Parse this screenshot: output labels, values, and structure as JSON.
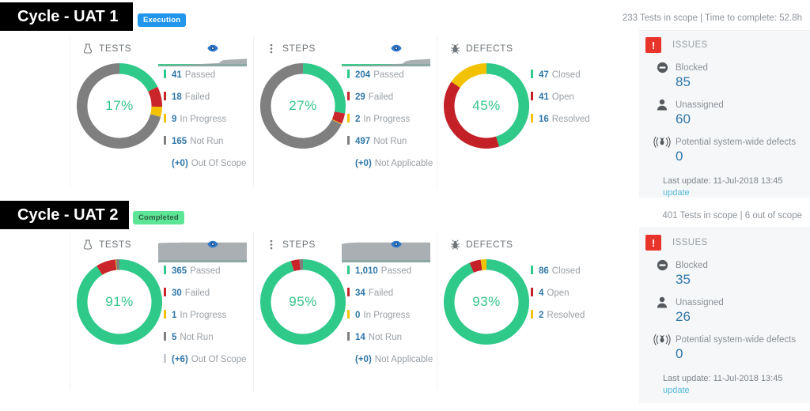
{
  "colors": {
    "passed": "#2fc98a",
    "failed": "#c9252b",
    "in_progress": "#f2c200",
    "not_run": "#7f7f7f",
    "out_of_scope": "#c9ccd0",
    "closed": "#2fc98a",
    "open": "#c42027",
    "resolved": "#f2c200",
    "accent_blue": "#2f77a8",
    "alert_red": "#e8342a",
    "chip_execution": "#2196ec",
    "chip_completed": "#5ce595"
  },
  "cycles": [
    {
      "title": "Cycle - UAT 1",
      "status": "Execution",
      "scope_line": "233 Tests in scope | Time to complete: 52.8h",
      "widgets": [
        {
          "name": "TESTS",
          "icon": "flask-icon",
          "percent": "17%",
          "percent_value": 17,
          "sparkline": [
            4,
            4,
            5,
            5,
            6,
            6,
            7,
            8,
            9,
            10,
            11,
            12,
            13,
            14,
            15,
            16,
            30,
            32,
            33,
            34,
            35,
            36,
            37
          ],
          "legend": [
            {
              "value": "41",
              "label": "Passed",
              "color": "#2fc98a"
            },
            {
              "value": "18",
              "label": "Failed",
              "color": "#c9252b"
            },
            {
              "value": "9",
              "label": "In Progress",
              "color": "#f2c200"
            },
            {
              "value": "165",
              "label": "Not Run",
              "color": "#7f7f7f"
            },
            {
              "value": "(+0)",
              "label": "Out Of Scope",
              "color": "none"
            }
          ],
          "segments": [
            {
              "label": "Passed",
              "value": 41,
              "color": "#2fc98a"
            },
            {
              "label": "Failed",
              "value": 18,
              "color": "#c9252b"
            },
            {
              "label": "In Progress",
              "value": 9,
              "color": "#f2c200"
            },
            {
              "label": "Not Run",
              "value": 165,
              "color": "#7f7f7f"
            }
          ]
        },
        {
          "name": "STEPS",
          "icon": "steps-icon",
          "percent": "27%",
          "percent_value": 27,
          "sparkline": [
            3,
            3,
            4,
            4,
            4,
            5,
            5,
            6,
            6,
            7,
            8,
            9,
            10,
            11,
            12,
            13,
            26,
            30,
            32,
            33,
            34,
            35,
            36
          ],
          "legend": [
            {
              "value": "204",
              "label": "Passed",
              "color": "#2fc98a"
            },
            {
              "value": "29",
              "label": "Failed",
              "color": "#c9252b"
            },
            {
              "value": "2",
              "label": "In Progress",
              "color": "#f2c200"
            },
            {
              "value": "497",
              "label": "Not Run",
              "color": "#7f7f7f"
            },
            {
              "value": "(+0)",
              "label": "Not Applicable",
              "color": "none"
            }
          ],
          "segments": [
            {
              "label": "Passed",
              "value": 204,
              "color": "#2fc98a"
            },
            {
              "label": "Failed",
              "value": 29,
              "color": "#c9252b"
            },
            {
              "label": "In Progress",
              "value": 2,
              "color": "#f2c200"
            },
            {
              "label": "Not Run",
              "value": 497,
              "color": "#7f7f7f"
            }
          ]
        },
        {
          "name": "DEFECTS",
          "icon": "bug-icon",
          "percent": "45%",
          "percent_value": 45,
          "sparkline": null,
          "legend": [
            {
              "value": "47",
              "label": "Closed",
              "color": "#2fc98a"
            },
            {
              "value": "41",
              "label": "Open",
              "color": "#c42027"
            },
            {
              "value": "16",
              "label": "Resolved",
              "color": "#f2c200"
            }
          ],
          "segments": [
            {
              "label": "Closed",
              "value": 47,
              "color": "#2fc98a"
            },
            {
              "label": "Open",
              "value": 41,
              "color": "#c42027"
            },
            {
              "label": "Resolved",
              "value": 16,
              "color": "#f2c200"
            }
          ]
        }
      ],
      "issues": {
        "title": "ISSUES",
        "rows": [
          {
            "icon": "blocked-icon",
            "label": "Blocked",
            "value": "85"
          },
          {
            "icon": "user-icon",
            "label": "Unassigned",
            "value": "60"
          },
          {
            "icon": "broadcast-icon",
            "label": "Potential system-wide defects",
            "value": "0"
          }
        ],
        "last_update": "Last update: 11-Jul-2018 13:45",
        "update_link": "update"
      }
    },
    {
      "title": "Cycle - UAT 2",
      "status": "Completed",
      "scope_line": "401 Tests in scope | 6 out of scope",
      "widgets": [
        {
          "name": "TESTS",
          "icon": "flask-icon",
          "percent": "91%",
          "percent_value": 91,
          "sparkline": [
            94,
            95,
            95,
            96,
            96,
            96,
            97,
            97,
            97,
            97,
            97,
            97,
            97,
            97,
            97,
            97,
            97,
            97,
            97,
            97,
            97,
            97,
            97
          ],
          "legend": [
            {
              "value": "365",
              "label": "Passed",
              "color": "#2fc98a"
            },
            {
              "value": "30",
              "label": "Failed",
              "color": "#c9252b"
            },
            {
              "value": "1",
              "label": "In Progress",
              "color": "#f2c200"
            },
            {
              "value": "5",
              "label": "Not Run",
              "color": "#7f7f7f"
            },
            {
              "value": "(+6)",
              "label": "Out Of Scope",
              "color": "#c9ccd0"
            }
          ],
          "segments": [
            {
              "label": "Passed",
              "value": 365,
              "color": "#2fc98a"
            },
            {
              "label": "Failed",
              "value": 30,
              "color": "#c9252b"
            },
            {
              "label": "In Progress",
              "value": 1,
              "color": "#f2c200"
            },
            {
              "label": "Not Run",
              "value": 5,
              "color": "#7f7f7f"
            }
          ]
        },
        {
          "name": "STEPS",
          "icon": "steps-icon",
          "percent": "95%",
          "percent_value": 95,
          "sparkline": [
            90,
            93,
            95,
            96,
            97,
            97,
            97,
            97,
            97,
            97,
            97,
            97,
            97,
            97,
            97,
            97,
            97,
            97,
            97,
            97,
            97,
            97,
            97
          ],
          "legend": [
            {
              "value": "1,010",
              "label": "Passed",
              "color": "#2fc98a"
            },
            {
              "value": "34",
              "label": "Failed",
              "color": "#c9252b"
            },
            {
              "value": "0",
              "label": "In Progress",
              "color": "#f2c200"
            },
            {
              "value": "14",
              "label": "Not Run",
              "color": "#7f7f7f"
            },
            {
              "value": "(+0)",
              "label": "Not Applicable",
              "color": "none"
            }
          ],
          "segments": [
            {
              "label": "Passed",
              "value": 1010,
              "color": "#2fc98a"
            },
            {
              "label": "Failed",
              "value": 34,
              "color": "#c9252b"
            },
            {
              "label": "In Progress",
              "value": 0,
              "color": "#f2c200"
            },
            {
              "label": "Not Run",
              "value": 14,
              "color": "#7f7f7f"
            }
          ]
        },
        {
          "name": "DEFECTS",
          "icon": "bug-icon",
          "percent": "93%",
          "percent_value": 93,
          "sparkline": null,
          "legend": [
            {
              "value": "86",
              "label": "Closed",
              "color": "#2fc98a"
            },
            {
              "value": "4",
              "label": "Open",
              "color": "#c42027"
            },
            {
              "value": "2",
              "label": "Resolved",
              "color": "#f2c200"
            }
          ],
          "segments": [
            {
              "label": "Closed",
              "value": 86,
              "color": "#2fc98a"
            },
            {
              "label": "Open",
              "value": 4,
              "color": "#c42027"
            },
            {
              "label": "Resolved",
              "value": 2,
              "color": "#f2c200"
            }
          ]
        }
      ],
      "issues": {
        "title": "ISSUES",
        "rows": [
          {
            "icon": "blocked-icon",
            "label": "Blocked",
            "value": "35"
          },
          {
            "icon": "user-icon",
            "label": "Unassigned",
            "value": "26"
          },
          {
            "icon": "broadcast-icon",
            "label": "Potential system-wide defects",
            "value": "0"
          }
        ],
        "last_update": "Last update: 11-Jul-2018 13:45",
        "update_link": "update"
      }
    }
  ]
}
